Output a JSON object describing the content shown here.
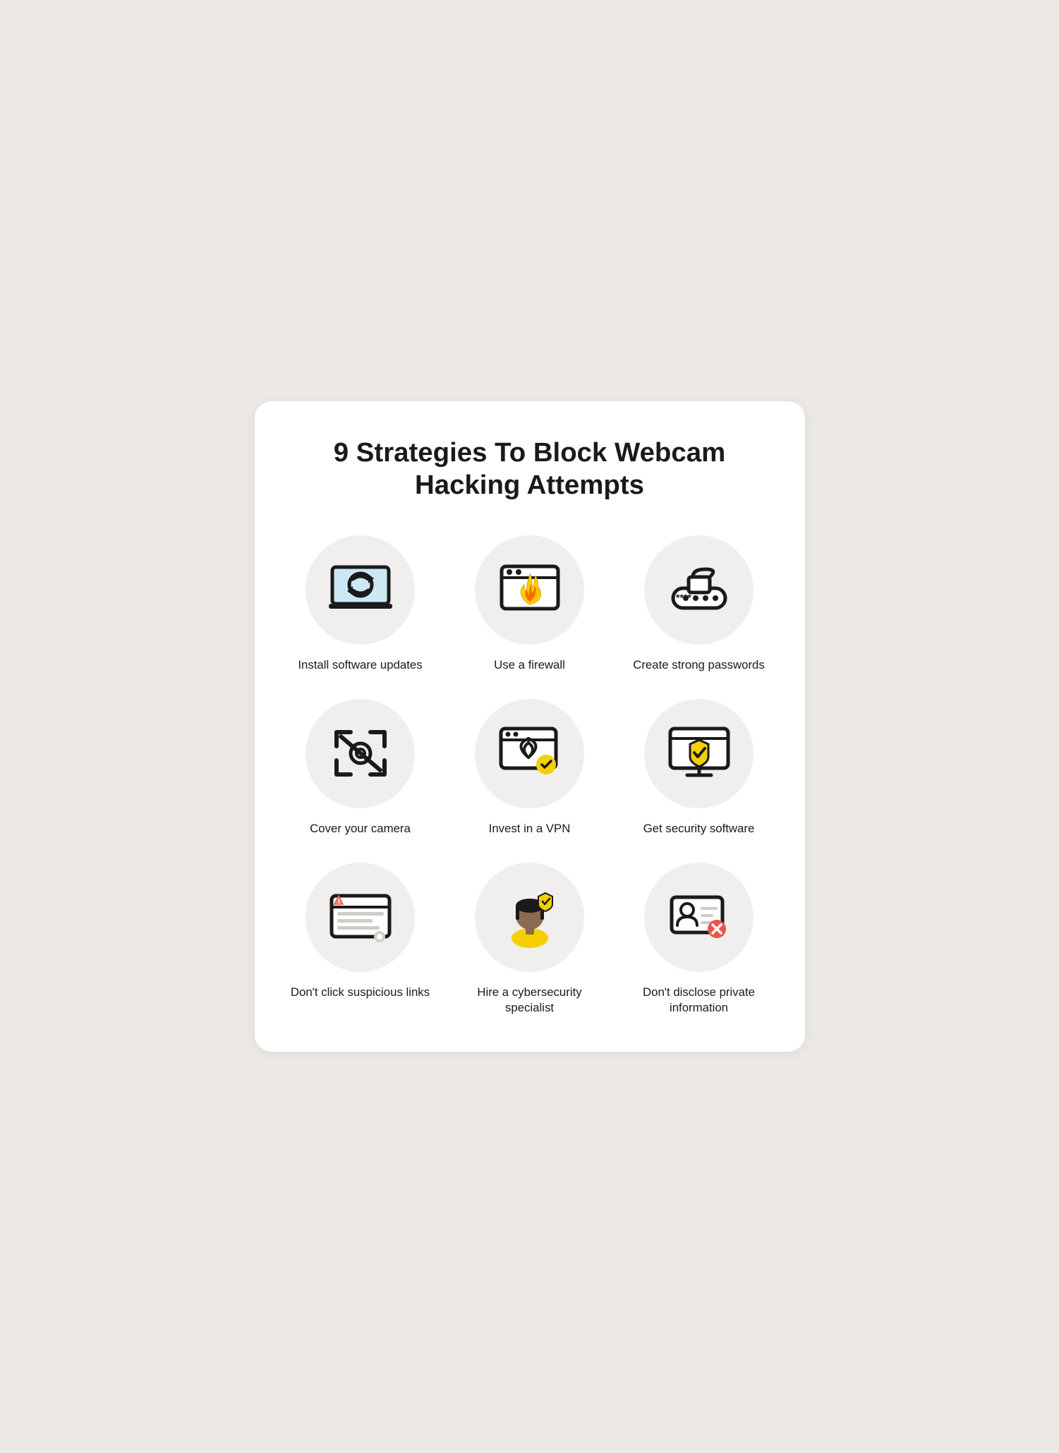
{
  "title": "9 Strategies To Block Webcam Hacking Attempts",
  "items": [
    {
      "id": "install-software-updates",
      "label": "Install software updates",
      "icon": "laptop-refresh"
    },
    {
      "id": "use-a-firewall",
      "label": "Use a firewall",
      "icon": "firewall"
    },
    {
      "id": "create-strong-passwords",
      "label": "Create strong passwords",
      "icon": "password"
    },
    {
      "id": "cover-your-camera",
      "label": "Cover your camera",
      "icon": "camera-off"
    },
    {
      "id": "invest-in-a-vpn",
      "label": "Invest in a VPN",
      "icon": "vpn"
    },
    {
      "id": "get-security-software",
      "label": "Get security software",
      "icon": "security-software"
    },
    {
      "id": "dont-click-suspicious-links",
      "label": "Don't click suspicious links",
      "icon": "suspicious-links"
    },
    {
      "id": "hire-cybersecurity-specialist",
      "label": "Hire a cybersecurity specialist",
      "icon": "specialist"
    },
    {
      "id": "dont-disclose-private-information",
      "label": "Don't disclose private information",
      "icon": "no-private-info"
    }
  ],
  "colors": {
    "background": "#ece9e4",
    "card": "#ffffff",
    "circle": "#f0efed",
    "text": "#1a1a1a",
    "yellow": "#f5d000",
    "red": "#e8574a",
    "green": "#4caf50"
  }
}
